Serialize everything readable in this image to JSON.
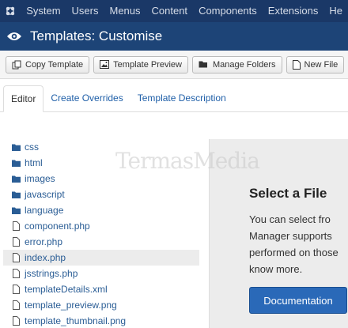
{
  "topnav": {
    "items": [
      "System",
      "Users",
      "Menus",
      "Content",
      "Components",
      "Extensions",
      "He"
    ]
  },
  "header": {
    "title": "Templates: Customise"
  },
  "toolbar": {
    "copy_template": "Copy Template",
    "template_preview": "Template Preview",
    "manage_folders": "Manage Folders",
    "new_file": "New File"
  },
  "tabs": [
    "Editor",
    "Create Overrides",
    "Template Description"
  ],
  "files": [
    {
      "name": "css",
      "type": "folder"
    },
    {
      "name": "html",
      "type": "folder"
    },
    {
      "name": "images",
      "type": "folder"
    },
    {
      "name": "javascript",
      "type": "folder"
    },
    {
      "name": "language",
      "type": "folder"
    },
    {
      "name": "component.php",
      "type": "file"
    },
    {
      "name": "error.php",
      "type": "file"
    },
    {
      "name": "index.php",
      "type": "file",
      "selected": true
    },
    {
      "name": "jsstrings.php",
      "type": "file"
    },
    {
      "name": "templateDetails.xml",
      "type": "file"
    },
    {
      "name": "template_preview.png",
      "type": "file"
    },
    {
      "name": "template_thumbnail.png",
      "type": "file"
    }
  ],
  "panel": {
    "heading": "Select a File",
    "lines": [
      "You can select fro",
      "Manager supports",
      "performed on those",
      "know more."
    ],
    "button": "Documentation"
  },
  "watermark": "TermasMedia",
  "colors": {
    "topnav_bg": "#1a3867",
    "titlebar_bg": "#1d4477",
    "link": "#2a5d95",
    "primary_button": "#2a69b8"
  }
}
